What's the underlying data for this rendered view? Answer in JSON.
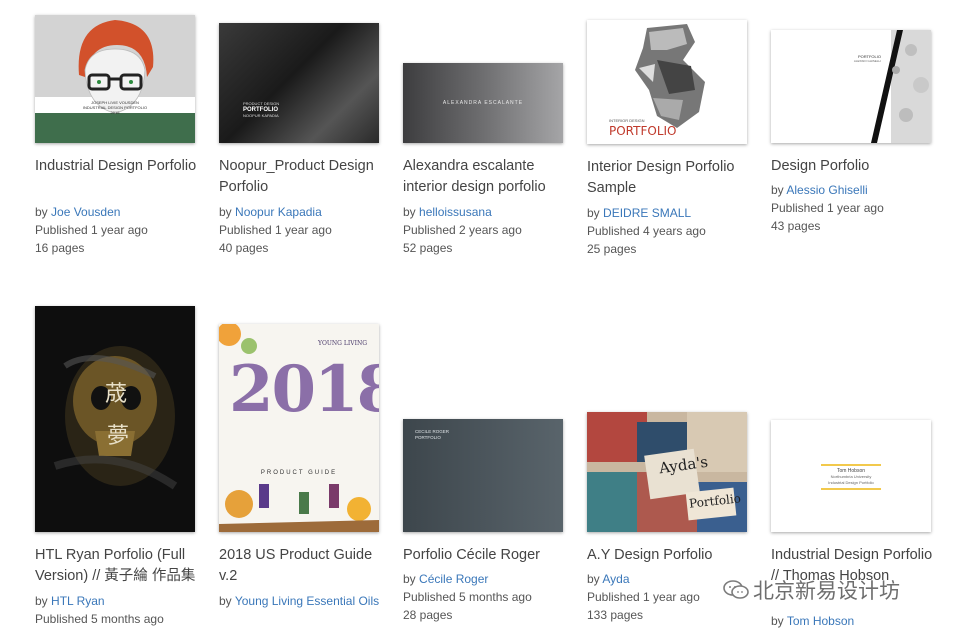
{
  "cards": [
    {
      "title": "Industrial Design Porfolio",
      "by": "by",
      "author": "Joe Vousden",
      "published": "Published 1 year ago",
      "pages": "16 pages",
      "cover_name": "JOSEPH LIVIE VOUSDEN",
      "cover_sub": "INDUSTRIAL DESIGN PORTFOLIO",
      "cover_year": "2015"
    },
    {
      "title": "Noopur_Product Design Porfolio",
      "by": "by",
      "author": "Noopur Kapadia",
      "published": "Published 1 year ago",
      "pages": "40 pages",
      "cover_top": "PRODUCT DESIGN",
      "cover_main": "PORTFOLIO",
      "cover_sub": "NOOPUR KAPADIA"
    },
    {
      "title": "Alexandra escalante interior design porfolio",
      "by": "by",
      "author": "helloissusana",
      "published": "Published 2 years ago",
      "pages": "52 pages",
      "cover_text": "ALEXANDRA ESCALANTE"
    },
    {
      "title": "Interior Design Porfolio Sample",
      "by": "by",
      "author": "DEIDRE SMALL",
      "published": "Published 4 years ago",
      "pages": "25 pages",
      "cover_small": "INTERIOR DESIGN",
      "cover_main": "PORTFOLIO"
    },
    {
      "title": "Design Porfolio",
      "by": "by",
      "author": "Alessio Ghiselli",
      "published": "Published 1 year ago",
      "pages": "43 pages",
      "cover_main": "PORTFOLIO",
      "cover_sub": "ALESSIO GHISELLI"
    },
    {
      "title": "HTL Ryan Porfolio (Full Version) // 黃子綸 作品集",
      "by": "by",
      "author": "HTL Ryan",
      "published": "Published 5 months ago",
      "pages": "",
      "cover_char1": "荿",
      "cover_char2": "夢"
    },
    {
      "title": "2018 US Product Guide v.2",
      "by": "by",
      "author": "Young Living Essential Oils",
      "published": "",
      "pages": "",
      "cover_brand": "YOUNG LIVING",
      "cover_year": "2018",
      "cover_guide": "PRODUCT GUIDE"
    },
    {
      "title": "Porfolio Cécile Roger",
      "by": "by",
      "author": "Cécile Roger",
      "published": "Published 5 months ago",
      "pages": "28 pages",
      "cover_name": "CECILE ROGER",
      "cover_sub": "PORTFOLIO"
    },
    {
      "title": "A.Y Design Porfolio",
      "by": "by",
      "author": "Ayda",
      "published": "Published 1 year ago",
      "pages": "133 pages",
      "cover_word1": "Ayda's",
      "cover_word2": "Portfolio"
    },
    {
      "title": "Industrial Design Porfolio // Thomas Hobson",
      "by": "by",
      "author": "Tom Hobson",
      "published": "",
      "pages": "",
      "cover_name": "Tom Hobson",
      "cover_uni": "Northumbria University",
      "cover_sub": "Industrial Design Portfolio"
    }
  ],
  "watermark": {
    "text": "北京新易设计坊",
    "icon": "wechat-icon"
  },
  "colors": {
    "link": "#3a77b9",
    "title": "#444444",
    "meta": "#555555"
  }
}
